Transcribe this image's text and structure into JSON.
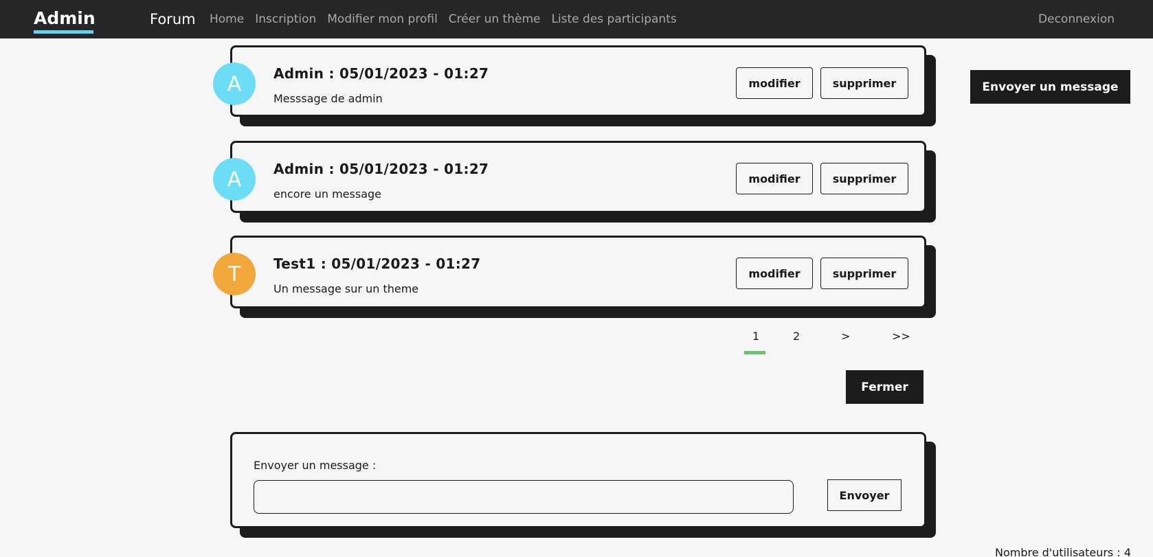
{
  "nav": {
    "brand": "Admin",
    "title": "Forum",
    "links": [
      "Home",
      "Inscription",
      "Modifier mon profil",
      "Créer un thème",
      "Liste des participants"
    ],
    "logout": "Deconnexion"
  },
  "side_button": "Envoyer un message",
  "messages": [
    {
      "initial": "A",
      "avatar_color": "#6ddcf5",
      "header": "Admin : 05/01/2023 - 01:27",
      "body": "Messsage de admin"
    },
    {
      "initial": "A",
      "avatar_color": "#6ddcf5",
      "header": "Admin : 05/01/2023 - 01:27",
      "body": "encore un message"
    },
    {
      "initial": "T",
      "avatar_color": "#f2a73b",
      "header": "Test1 : 05/01/2023 - 01:27",
      "body": "Un message sur un theme"
    }
  ],
  "message_actions": {
    "edit": "modifier",
    "delete": "supprimer"
  },
  "pagination": {
    "pages": [
      "1",
      "2",
      ">",
      ">>"
    ],
    "active": "1"
  },
  "close_button": "Fermer",
  "compose": {
    "label": "Envoyer un message :",
    "value": "",
    "submit": "Envoyer"
  },
  "footer": {
    "user_count": "Nombre d'utilisateurs : 4"
  }
}
